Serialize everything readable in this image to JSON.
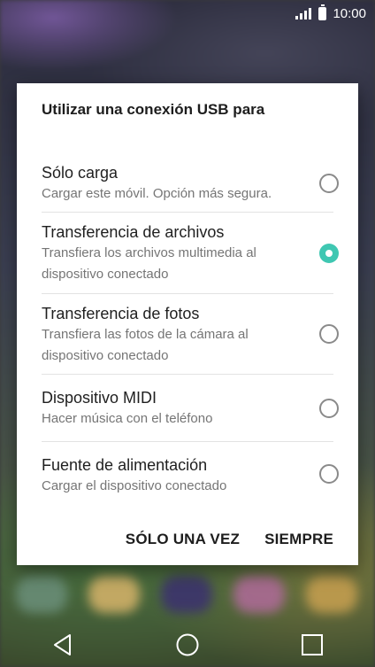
{
  "status_bar": {
    "time": "10:00",
    "signal_icon": "signal-icon",
    "battery_icon": "battery-icon"
  },
  "dialog": {
    "title": "Utilizar una conexión USB para",
    "options": [
      {
        "title": "Sólo carga",
        "subtitle": "Cargar este móvil. Opción más segura.",
        "selected": false
      },
      {
        "title": "Transferencia de archivos",
        "subtitle": "Transfiera los archivos multimedia al dispositivo conectado",
        "selected": true
      },
      {
        "title": "Transferencia de fotos",
        "subtitle": "Transfiera las fotos de la cámara al dispositivo conectado",
        "selected": false
      },
      {
        "title": "Dispositivo MIDI",
        "subtitle": "Hacer música con el teléfono",
        "selected": false
      },
      {
        "title": "Fuente de alimentación",
        "subtitle": "Cargar el dispositivo conectado",
        "selected": false
      }
    ],
    "actions": {
      "once": "SÓLO UNA VEZ",
      "always": "SIEMPRE"
    }
  },
  "nav_bar": {
    "back_icon": "back-icon",
    "home_icon": "home-icon",
    "recents_icon": "recents-icon"
  },
  "colors": {
    "accent": "#3fc7b2",
    "dialog_bg": "#ffffff",
    "secondary_text": "#757575"
  }
}
